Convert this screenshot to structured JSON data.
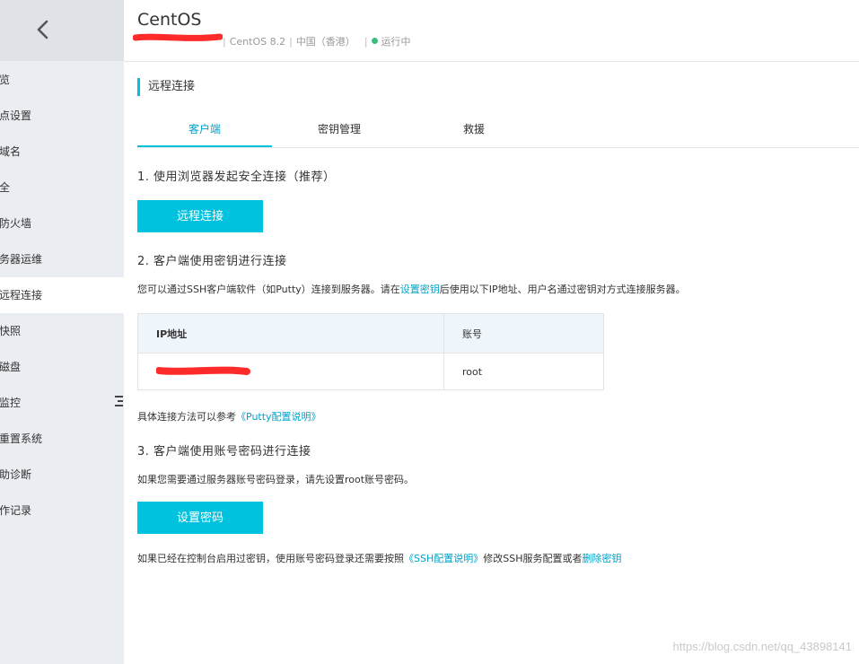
{
  "sidebar": {
    "items": [
      {
        "label": "览"
      },
      {
        "label": "点设置"
      },
      {
        "label": "域名"
      },
      {
        "label": "全"
      },
      {
        "label": "防火墙"
      },
      {
        "label": "务器运维"
      },
      {
        "label": "远程连接"
      },
      {
        "label": "快照"
      },
      {
        "label": "磁盘"
      },
      {
        "label": "监控"
      },
      {
        "label": "重置系统"
      },
      {
        "label": "助诊断"
      },
      {
        "label": "作记录"
      }
    ]
  },
  "header": {
    "title": "CentOS",
    "os": "CentOS 8.2",
    "region": "中国（香港）",
    "status": "运行中"
  },
  "section_title": "远程连接",
  "tabs": [
    {
      "label": "客户端"
    },
    {
      "label": "密钥管理"
    },
    {
      "label": "救援"
    }
  ],
  "step1": {
    "title": "1. 使用浏览器发起安全连接（推荐）",
    "button": "远程连接"
  },
  "step2": {
    "title": "2. 客户端使用密钥进行连接",
    "desc_pre": "您可以通过SSH客户端软件（如Putty）连接到服务器。请在",
    "desc_link": "设置密钥",
    "desc_post": "后使用以下IP地址、用户名通过密钥对方式连接服务器。",
    "table_headers": {
      "ip": "IP地址",
      "account": "账号"
    },
    "table_row": {
      "account": "root"
    },
    "ref_pre": "具体连接方法可以参考",
    "ref_link": "《Putty配置说明》"
  },
  "step3": {
    "title": "3. 客户端使用账号密码进行连接",
    "desc": "如果您需要通过服务器账号密码登录，请先设置root账号密码。",
    "button": "设置密码",
    "note_pre": "如果已经在控制台启用过密钥，使用账号密码登录还需要按照",
    "note_link1": "《SSH配置说明》",
    "note_mid": "修改SSH服务配置或者",
    "note_link2": "删除密钥"
  },
  "watermark": "https://blog.csdn.net/qq_43898141",
  "colors": {
    "accent": "#00c1de",
    "link": "#00a2ca",
    "status": "#3dbd7d",
    "redaction": "#ff2a2a"
  }
}
